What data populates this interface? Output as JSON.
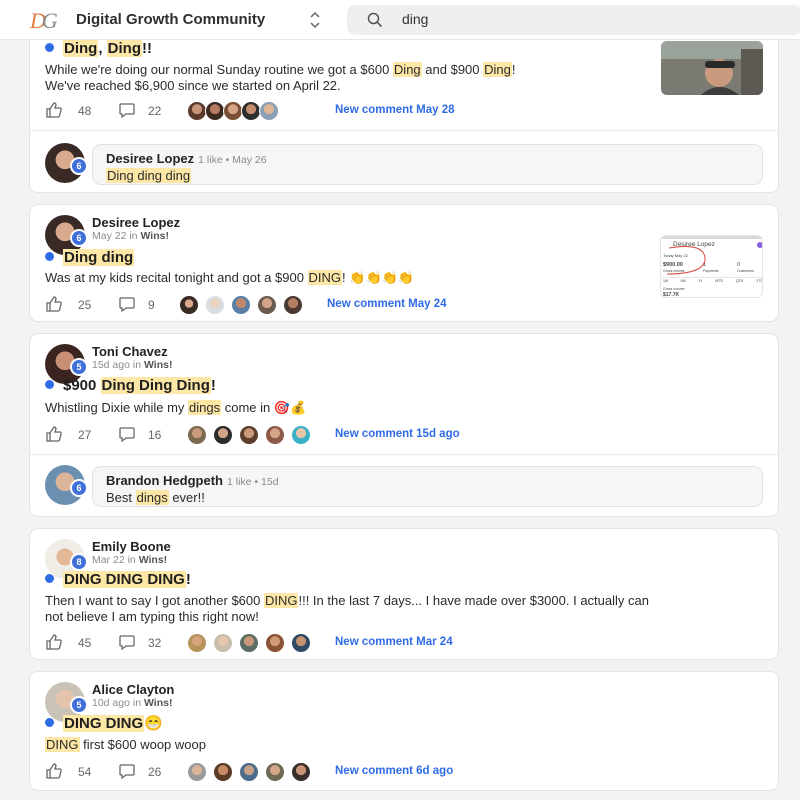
{
  "header": {
    "community_name": "Digital Growth Community",
    "logo_text": "DG",
    "search_value": "ding",
    "search_placeholder": "Search"
  },
  "posts": [
    {
      "title_parts": [
        "Ding",
        ", ",
        "Ding",
        "!!"
      ],
      "body_parts": [
        "While we're doing our normal Sunday routine we got a $600 ",
        "Ding",
        " and $900 ",
        "Ding",
        "!"
      ],
      "body_line2": "We've reached $6,900 since we started on April 22.",
      "likes": "48",
      "comments": "22",
      "new_comment": "New comment May 28",
      "top_comment": {
        "author": "Desiree Lopez",
        "level": "6",
        "meta": "1 like • May 26",
        "text_parts": [
          "Ding ding ding"
        ]
      }
    },
    {
      "author": "Desiree Lopez",
      "level": "6",
      "meta_time": "May 22 in ",
      "meta_category": "Wins!",
      "title_parts": [
        "Ding ding"
      ],
      "body_parts": [
        "Was at my kids recital tonight and got a $900 ",
        "DING",
        "! 👏👏👏👏"
      ],
      "likes": "25",
      "comments": "9",
      "new_comment": "New comment May 24",
      "thumb_text": {
        "name": "Desiree Lopez",
        "date": "Today May 22",
        "amount": "$900.00",
        "payments": "1",
        "customers": "0",
        "gross": "Gross volume",
        "pay_label": "Payments",
        "cust_label": "Customers",
        "tabs": [
          "1M",
          "6M",
          "1Y",
          "MTD",
          "QTD",
          "YTD"
        ],
        "gross2": "Gross volume",
        "total": "$17.7K"
      }
    },
    {
      "author": "Toni Chavez",
      "level": "5",
      "meta_time": "15d ago in ",
      "meta_category": "Wins!",
      "title_parts": [
        "$900 ",
        "Ding Ding Ding",
        "!"
      ],
      "body_parts": [
        "Whistling Dixie while my ",
        "dings",
        " come in 🎯💰"
      ],
      "likes": "27",
      "comments": "16",
      "new_comment": "New comment 15d ago",
      "top_comment": {
        "author": "Brandon Hedgpeth",
        "level": "6",
        "meta": "1 like • 15d",
        "text_parts": [
          "Best ",
          "dings",
          " ever!!"
        ]
      }
    },
    {
      "author": "Emily Boone",
      "level": "8",
      "meta_time": "Mar 22 in ",
      "meta_category": "Wins!",
      "title_parts": [
        "DING DING DING",
        "!"
      ],
      "body_parts": [
        "Then I want to say I got another $600 ",
        "DING",
        "!!! In the last 7 days... I have made over $3000. I actually can"
      ],
      "body_line2": "not believe I am typing this right now!",
      "likes": "45",
      "comments": "32",
      "new_comment": "New comment Mar 24"
    },
    {
      "author": "Alice Clayton",
      "level": "5",
      "meta_time": "10d ago in ",
      "meta_category": "Wins!",
      "title_parts": [
        "DING DING",
        "😁"
      ],
      "body_parts": [
        "DING",
        " first $600 woop woop"
      ],
      "likes": "54",
      "comments": "26",
      "new_comment": "New comment 6d ago"
    }
  ],
  "colors": {
    "accent": "#2f6be5",
    "highlight": "#fde7a6",
    "badge": "#3f6fd8",
    "logo": "#e07a3c"
  },
  "icons": [
    "switcher-icon",
    "search-icon",
    "like-icon",
    "comment-icon"
  ]
}
